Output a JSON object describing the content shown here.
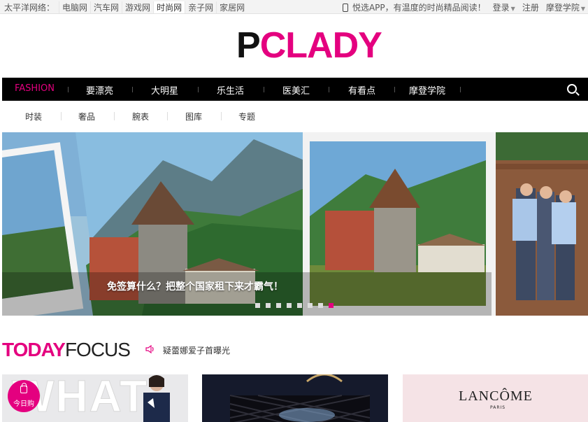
{
  "topbar": {
    "site": "太平洋网络：",
    "links": [
      "电脑网",
      "汽车网",
      "游戏网",
      "时尚网",
      "亲子网",
      "家居网"
    ],
    "app_promo": "悦选APP，有温度的时尚精品阅读！",
    "login": "登录",
    "register": "注册",
    "academy": "摩登学院"
  },
  "logo": {
    "p": "P",
    "c": "C",
    "rest": "LADY"
  },
  "mainnav": {
    "items": [
      "FASHION",
      "要漂亮",
      "大明星",
      "乐生活",
      "医美汇",
      "有看点",
      "摩登学院"
    ]
  },
  "subnav": {
    "items": [
      "时装",
      "奢品",
      "腕表",
      "图库",
      "专题"
    ]
  },
  "banner": {
    "caption": "免签算什么？把整个国家租下来才霸气！",
    "slide_count": 8,
    "active_slide": 8
  },
  "today_focus": {
    "today": "TODAY",
    "focus": "FOCUS",
    "news": "疑蕾娜爱子首曝光"
  },
  "cards": {
    "card1_text": "WHAT",
    "card3_brand": "LANCÔME",
    "card3_sub": "PARIS"
  },
  "shop_badge": "今日购",
  "colors": {
    "accent": "#e4007f",
    "nav_bg": "#000000"
  }
}
